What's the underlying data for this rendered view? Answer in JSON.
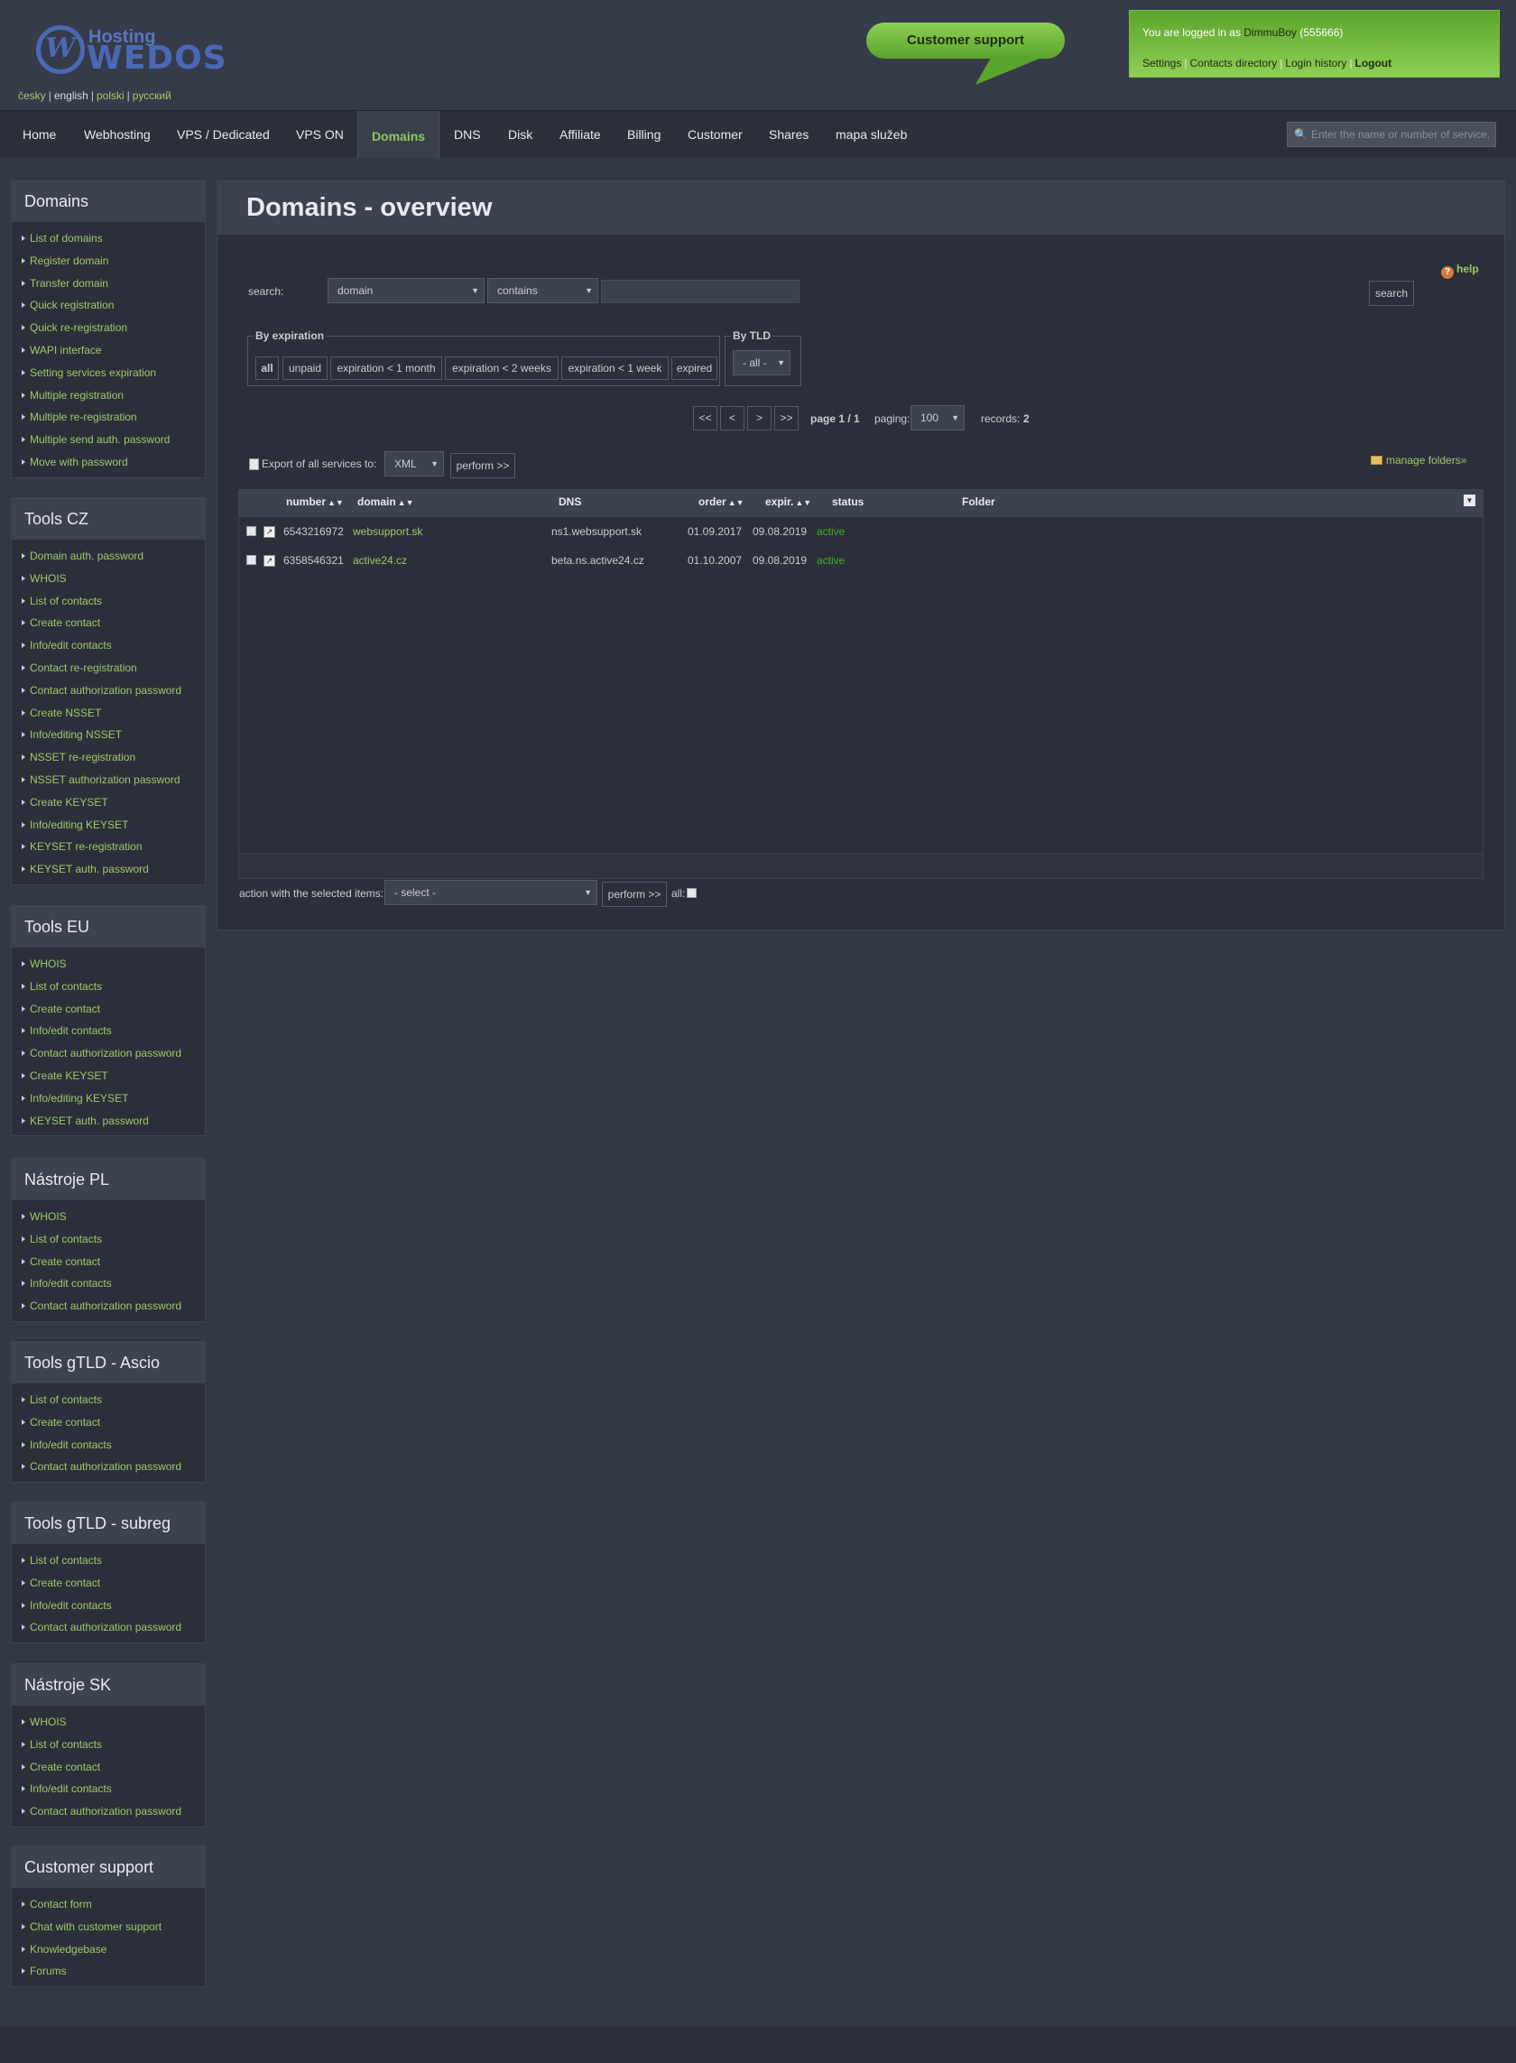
{
  "header": {
    "logo_hosting": "Hosting",
    "logo_wedos": "WEDOS",
    "logo_mark": "W",
    "languages": [
      {
        "label": "česky"
      },
      {
        "label": "english"
      },
      {
        "label": "polski"
      },
      {
        "label": "русский"
      }
    ],
    "support_label": "Customer support",
    "login_prefix": "You are logged in as",
    "login_user": "DimmuBoy",
    "login_id": "(555666)",
    "links": [
      "Settings",
      "Contacts directory",
      "Login history",
      "Logout"
    ]
  },
  "nav": {
    "items": [
      "Home",
      "Webhosting",
      "VPS / Dedicated",
      "VPS ON",
      "Domains",
      "DNS",
      "Disk",
      "Affiliate",
      "Billing",
      "Customer",
      "Shares",
      "mapa služeb"
    ],
    "active": "Domains",
    "search_placeholder": "Enter the name or number of service."
  },
  "sidebar": [
    {
      "title": "Domains",
      "items": [
        "List of domains",
        "Register domain",
        "Transfer domain",
        "Quick registration",
        "Quick re-registration",
        "WAPI interface",
        "Setting services expiration",
        "Multiple registration",
        "Multiple re-registration",
        "Multiple send auth. password",
        "Move with password"
      ]
    },
    {
      "title": "Tools CZ",
      "items": [
        "Domain auth. password",
        "WHOIS",
        "List of contacts",
        "Create contact",
        "Info/edit contacts",
        "Contact re-registration",
        "Contact authorization password",
        "Create NSSET",
        "Info/editing NSSET",
        "NSSET re-registration",
        "NSSET authorization password",
        "Create KEYSET",
        "Info/editing KEYSET",
        "KEYSET re-registration",
        "KEYSET auth. password"
      ]
    },
    {
      "title": "Tools EU",
      "items": [
        "WHOIS",
        "List of contacts",
        "Create contact",
        "Info/edit contacts",
        "Contact authorization password",
        "Create KEYSET",
        "Info/editing KEYSET",
        "KEYSET auth. password"
      ]
    },
    {
      "title": "Nástroje PL",
      "items": [
        "WHOIS",
        "List of contacts",
        "Create contact",
        "Info/edit contacts",
        "Contact authorization password"
      ]
    },
    {
      "title": "Tools gTLD - Ascio",
      "items": [
        "List of contacts",
        "Create contact",
        "Info/edit contacts",
        "Contact authorization password"
      ]
    },
    {
      "title": "Tools gTLD - subreg",
      "items": [
        "List of contacts",
        "Create contact",
        "Info/edit contacts",
        "Contact authorization password"
      ]
    },
    {
      "title": "Nástroje SK",
      "items": [
        "WHOIS",
        "List of contacts",
        "Create contact",
        "Info/edit contacts",
        "Contact authorization password"
      ]
    },
    {
      "title": "Customer support",
      "items": [
        "Contact form",
        "Chat with customer support",
        "Knowledgebase",
        "Forums"
      ]
    }
  ],
  "main": {
    "title": "Domains - overview",
    "help": "help",
    "search_label": "search:",
    "search_field": "domain",
    "search_op": "contains",
    "search_value": "",
    "search_button": "search",
    "expiration_legend": "By expiration",
    "expiration_filters": [
      "all",
      "unpaid",
      "expiration < 1 month",
      "expiration < 2 weeks",
      "expiration < 1 week",
      "expired"
    ],
    "tld_legend": "By TLD",
    "tld_value": "- all -",
    "pager": {
      "first": "<<",
      "prev": "<",
      "next": ">",
      "last": ">>",
      "page_text": "page 1 / 1",
      "paging_label": "paging:",
      "paging_value": "100",
      "records_label": "records:",
      "records_value": "2"
    },
    "export_label": "Export of all services to:",
    "export_format": "XML",
    "export_button": "perform >>",
    "manage_folders": "manage folders»",
    "columns": [
      "number",
      "domain",
      "DNS",
      "order",
      "expir.",
      "status",
      "Folder"
    ],
    "rows": [
      {
        "number": "6543216972",
        "domain": "websupport.sk",
        "dns": "ns1.websupport.sk",
        "order": "01.09.2017",
        "expir": "09.08.2019",
        "status": "active",
        "folder": ""
      },
      {
        "number": "6358546321",
        "domain": "active24.cz",
        "dns": "beta.ns.active24.cz",
        "order": "01.10.2007",
        "expir": "09.08.2019",
        "status": "active",
        "folder": ""
      }
    ],
    "action_label": "action with the selected items:",
    "action_value": "- select -",
    "action_button": "perform >>",
    "all_label": "all:"
  },
  "colors": {
    "accent": "#8fc85a",
    "link": "#9fc86a",
    "active_status": "#3fb21b",
    "support_green": "#5aa52c"
  }
}
